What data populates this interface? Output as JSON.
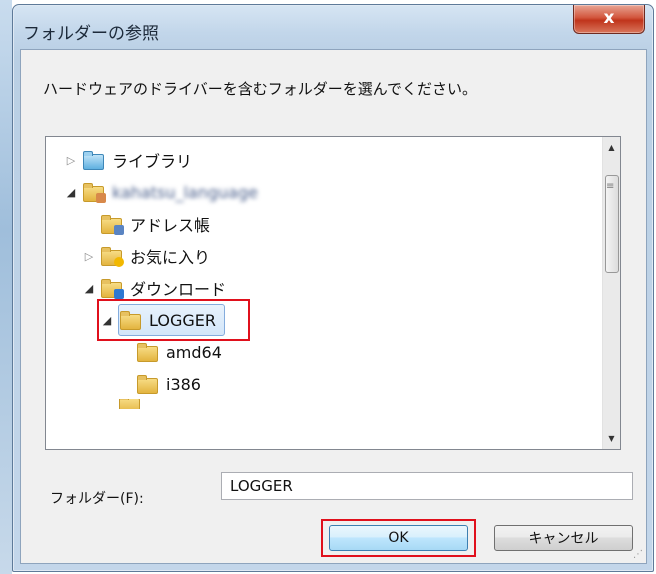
{
  "window": {
    "title": "フォルダーの参照",
    "close_glyph": "x"
  },
  "instruction": "ハードウェアのドライバーを含むフォルダーを選んでください。",
  "tree": {
    "items": [
      {
        "label": "ライブラリ",
        "icon": "library-folder-icon",
        "arrow": "▷"
      },
      {
        "label": "kahatsu_language",
        "icon": "user-folder-icon",
        "arrow": "◢"
      },
      {
        "label": "アドレス帳",
        "icon": "contacts-folder-icon",
        "arrow": ""
      },
      {
        "label": "お気に入り",
        "icon": "favorites-folder-icon",
        "arrow": "▷"
      },
      {
        "label": "ダウンロード",
        "icon": "downloads-folder-icon",
        "arrow": "◢"
      },
      {
        "label": "LOGGER",
        "icon": "folder-icon",
        "arrow": "◢",
        "selected": true
      },
      {
        "label": "amd64",
        "icon": "folder-icon",
        "arrow": ""
      },
      {
        "label": "i386",
        "icon": "folder-icon",
        "arrow": ""
      }
    ],
    "scroll_up": "▲",
    "scroll_down": "▼",
    "scroll_grip": "≡"
  },
  "folder_field": {
    "label": "フォルダー(F):",
    "value": "LOGGER"
  },
  "buttons": {
    "ok": "OK",
    "cancel": "キャンセル"
  },
  "colors": {
    "highlight_box": "#e0101c",
    "selection": "#d3e6f9"
  }
}
